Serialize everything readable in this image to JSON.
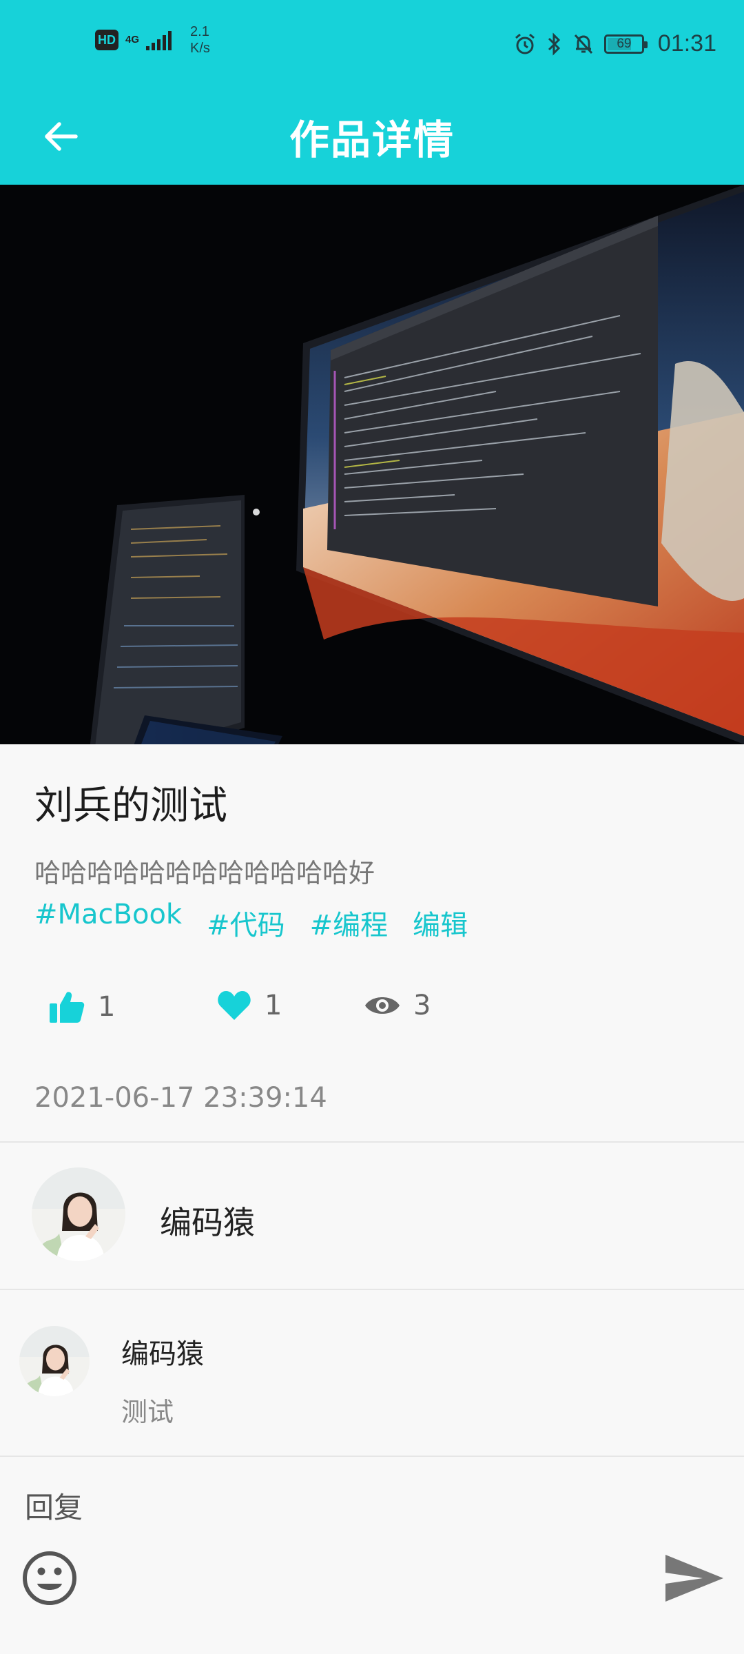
{
  "status_bar": {
    "network_badge": "HD",
    "network_type": "4G",
    "speed_value": "2.1",
    "speed_unit": "K/s",
    "battery_level": "69",
    "time": "01:31",
    "icons": [
      "alarm-icon",
      "bluetooth-icon",
      "mute-icon",
      "battery-icon"
    ]
  },
  "header": {
    "title": "作品详情",
    "back_icon": "arrow-left-icon"
  },
  "post": {
    "title": "刘兵的测试",
    "description": "哈哈哈哈哈哈哈哈哈哈哈哈好",
    "tags": [
      "#MacBook",
      "#代码",
      "#编程",
      "编辑"
    ],
    "likes": "1",
    "favorites": "1",
    "views": "3",
    "date": "2021-06-17 23:39:14"
  },
  "author": {
    "name": "编码猿"
  },
  "comments": [
    {
      "name": "编码猿",
      "text": "测试"
    }
  ],
  "reply": {
    "label": "回复",
    "placeholder": ""
  },
  "colors": {
    "accent": "#17d2d9",
    "tag": "#17c6cd"
  }
}
